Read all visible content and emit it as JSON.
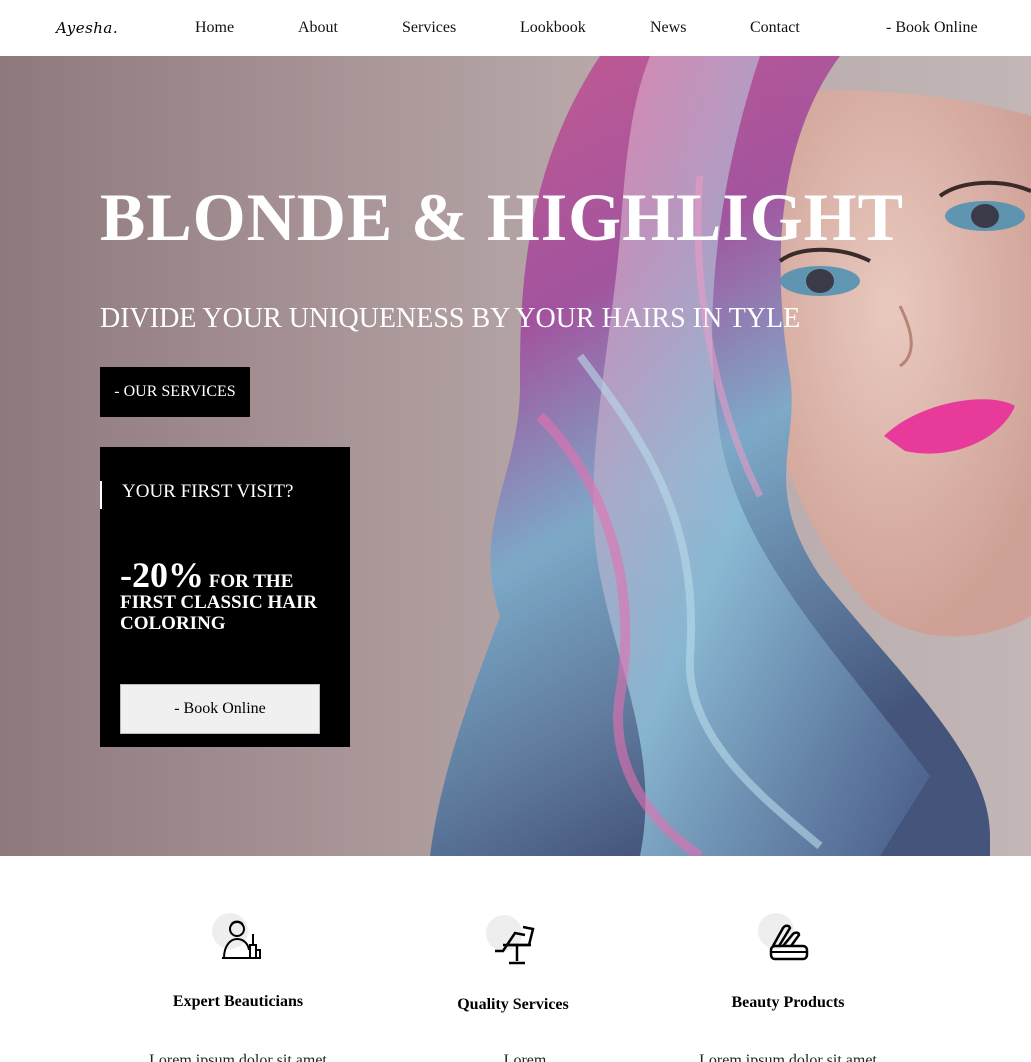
{
  "nav": {
    "logo": "Ayesha.",
    "links": [
      "Home",
      "About",
      "Services",
      "Lookbook",
      "News",
      "Contact"
    ],
    "book_online": "- Book Online"
  },
  "hero": {
    "title": "BLONDE & HIGHLIGHT",
    "subtitle": "DIVIDE YOUR UNIQUENESS BY YOUR HAIRS IN TYLE",
    "services_button": "- OUR SERVICES",
    "visit": {
      "title": "YOUR FIRST VISIT?",
      "discount": "-20%",
      "offer": "FOR THE FIRST CLASSIC HAIR COLORING",
      "book_button": "- Book Online"
    }
  },
  "features": [
    {
      "title": "Expert Beauticians",
      "icon": "beautician-icon",
      "text": "Lorem ipsum dolor sit amet"
    },
    {
      "title": "Quality Services",
      "icon": "salon-chair-icon",
      "text": "Lorem"
    },
    {
      "title": "Beauty Products",
      "icon": "cosmetics-icon",
      "text": "Lorem ipsum dolor sit amet"
    }
  ],
  "colors": {
    "hair_pink": "#d84a9c",
    "hair_blue": "#6fa6c8",
    "lips": "#e83a9a",
    "box_bg": "#000000"
  }
}
